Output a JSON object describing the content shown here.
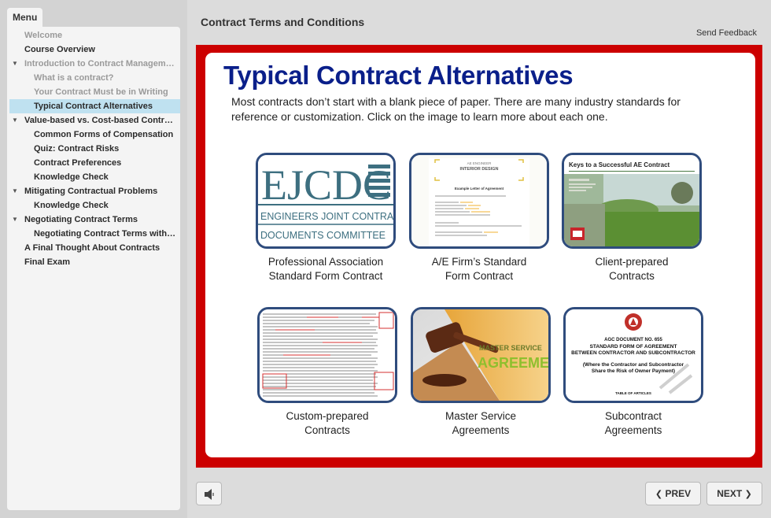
{
  "sidebar": {
    "menu_tab": "Menu",
    "items": [
      {
        "label": "Welcome",
        "level": 0,
        "state": "visited",
        "arrow": false
      },
      {
        "label": "Course Overview",
        "level": 0,
        "state": "normal",
        "arrow": false
      },
      {
        "label": "Introduction to Contract Management",
        "level": 0,
        "state": "visited",
        "arrow": true
      },
      {
        "label": "What is a contract?",
        "level": 1,
        "state": "visited",
        "arrow": false
      },
      {
        "label": "Your Contract Must be in Writing",
        "level": 1,
        "state": "visited",
        "arrow": false
      },
      {
        "label": "Typical Contract Alternatives",
        "level": 1,
        "state": "current",
        "arrow": false
      },
      {
        "label": "Value-based vs. Cost-based Contracts",
        "level": 0,
        "state": "normal",
        "arrow": true
      },
      {
        "label": "Common Forms of Compensation",
        "level": 1,
        "state": "normal",
        "arrow": false
      },
      {
        "label": "Quiz: Contract Risks",
        "level": 1,
        "state": "normal",
        "arrow": false
      },
      {
        "label": "Contract Preferences",
        "level": 1,
        "state": "normal",
        "arrow": false
      },
      {
        "label": "Knowledge Check",
        "level": 1,
        "state": "normal",
        "arrow": false
      },
      {
        "label": "Mitigating Contractual Problems",
        "level": 0,
        "state": "normal",
        "arrow": true
      },
      {
        "label": "Knowledge Check",
        "level": 1,
        "state": "normal",
        "arrow": false
      },
      {
        "label": "Negotiating Contract Terms",
        "level": 0,
        "state": "normal",
        "arrow": true
      },
      {
        "label": "Negotiating Contract Terms with Clients",
        "level": 1,
        "state": "normal",
        "arrow": false
      },
      {
        "label": "A Final Thought About Contracts",
        "level": 0,
        "state": "normal",
        "arrow": false
      },
      {
        "label": "Final Exam",
        "level": 0,
        "state": "normal",
        "arrow": false
      }
    ]
  },
  "header": {
    "title": "Contract Terms and Conditions",
    "feedback": "Send Feedback"
  },
  "slide": {
    "heading": "Typical Contract Alternatives",
    "intro": "Most contracts don’t start with a blank piece of paper. There are many industry standards for reference or customization. Click on the image to learn more about each one.",
    "tiles": [
      {
        "line1": "Professional Association",
        "line2": "Standard Form Contract"
      },
      {
        "line1": "A/E Firm’s Standard",
        "line2": "Form Contract"
      },
      {
        "line1": "Client-prepared",
        "line2": "Contracts"
      },
      {
        "line1": "Custom-prepared",
        "line2": "Contracts"
      },
      {
        "line1": "Master Service",
        "line2": "Agreements"
      },
      {
        "line1": "Subcontract",
        "line2": "Agreements"
      }
    ],
    "thumbs": {
      "ejcdc_logo": "EJCDC",
      "ejcdc_line1": "ENGINEERS JOINT CONTRACT",
      "ejcdc_line2": "DOCUMENTS COMMITTEE",
      "letter_firm": "AE ENGINEER",
      "letter_firm2": "INTERIOR DESIGN",
      "letter_title": "Example Letter of Agreement",
      "ae_title": "Keys to a Successful AE Contract",
      "msa_line1": "MASTER SERVICE",
      "msa_line2": "AGREEMENT",
      "agc_doc": "AGC DOCUMENT NO. 655",
      "agc_title1": "STANDARD FORM OF AGREEMENT",
      "agc_title2": "BETWEEN CONTRACTOR AND SUBCONTRACTOR",
      "agc_sub1": "(Where the Contractor and Subcontractor",
      "agc_sub2": "Share the Risk of Owner Payment)",
      "agc_toc": "TABLE OF ARTICLES"
    }
  },
  "footer": {
    "prev": "PREV",
    "next": "NEXT"
  },
  "colors": {
    "frame_red": "#cc0000",
    "heading_blue": "#0a1f8a",
    "thumb_border": "#2f4c7d",
    "menu_current": "#bfe1f0"
  }
}
